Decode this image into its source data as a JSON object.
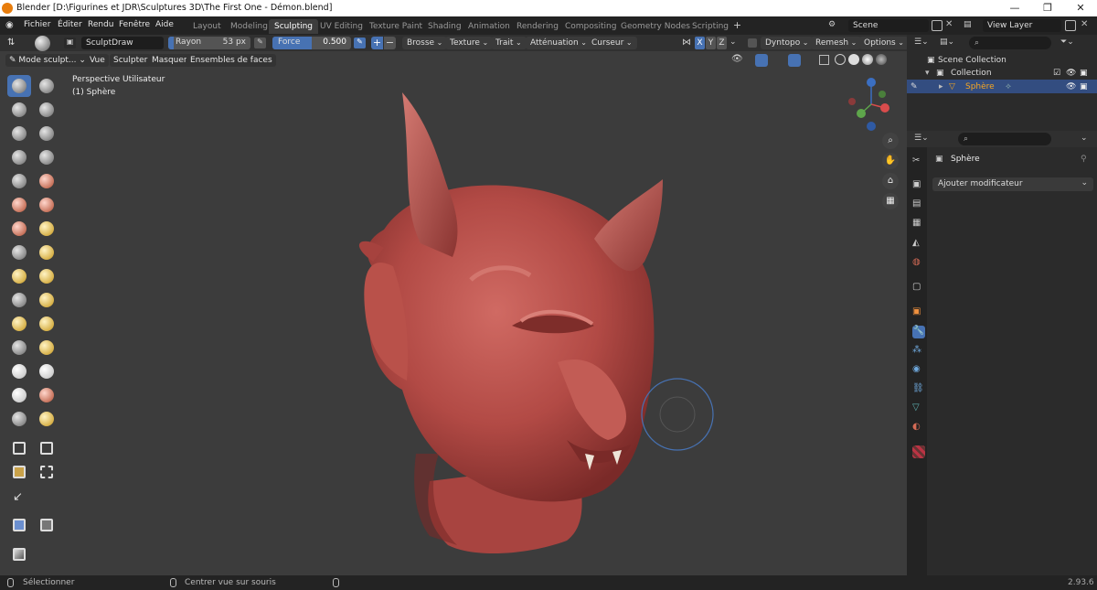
{
  "window": {
    "title": "Blender [D:\\Figurines et JDR\\Sculptures 3D\\The First One - Démon.blend]",
    "minimize": "—",
    "maximize": "❐",
    "close": "✕"
  },
  "menu": [
    "Fichier",
    "Éditer",
    "Rendu",
    "Fenêtre",
    "Aide"
  ],
  "workspaces": [
    "Layout",
    "Modeling",
    "Sculpting",
    "UV Editing",
    "Texture Paint",
    "Shading",
    "Animation",
    "Rendering",
    "Compositing",
    "Geometry Nodes",
    "Scripting"
  ],
  "active_workspace": "Sculpting",
  "scene": {
    "label": "Scene",
    "view_layer": "View Layer"
  },
  "tool_header": {
    "brush_name": "SculptDraw",
    "radius_label": "Rayon",
    "radius_value": "53 px",
    "strength_label": "Force",
    "strength_value": "0.500",
    "brush": "Brosse",
    "texture": "Texture",
    "stroke": "Trait",
    "falloff": "Atténuation",
    "cursor": "Curseur",
    "x": "X",
    "y": "Y",
    "z": "Z",
    "dyntopo": "Dyntopo",
    "remesh": "Remesh",
    "options": "Options"
  },
  "viewport_header": {
    "mode": "Mode sculpt...",
    "menu": [
      "Vue",
      "Sculpter",
      "Masquer",
      "Ensembles de faces"
    ]
  },
  "viewport": {
    "perspective": "Perspective Utilisateur",
    "object": "(1) Sphère"
  },
  "outliner": {
    "scene_collection": "Scene Collection",
    "collection": "Collection",
    "object": "Sphère"
  },
  "properties": {
    "object_name": "Sphère",
    "add_modifier": "Ajouter modificateur"
  },
  "status": {
    "select": "Sélectionner",
    "center_view": "Centrer vue sur souris",
    "version": "2.93.6"
  },
  "colors": {
    "accent": "#4772b3",
    "model": "#b24a45",
    "viewport_bg": "#3c3c3c"
  }
}
